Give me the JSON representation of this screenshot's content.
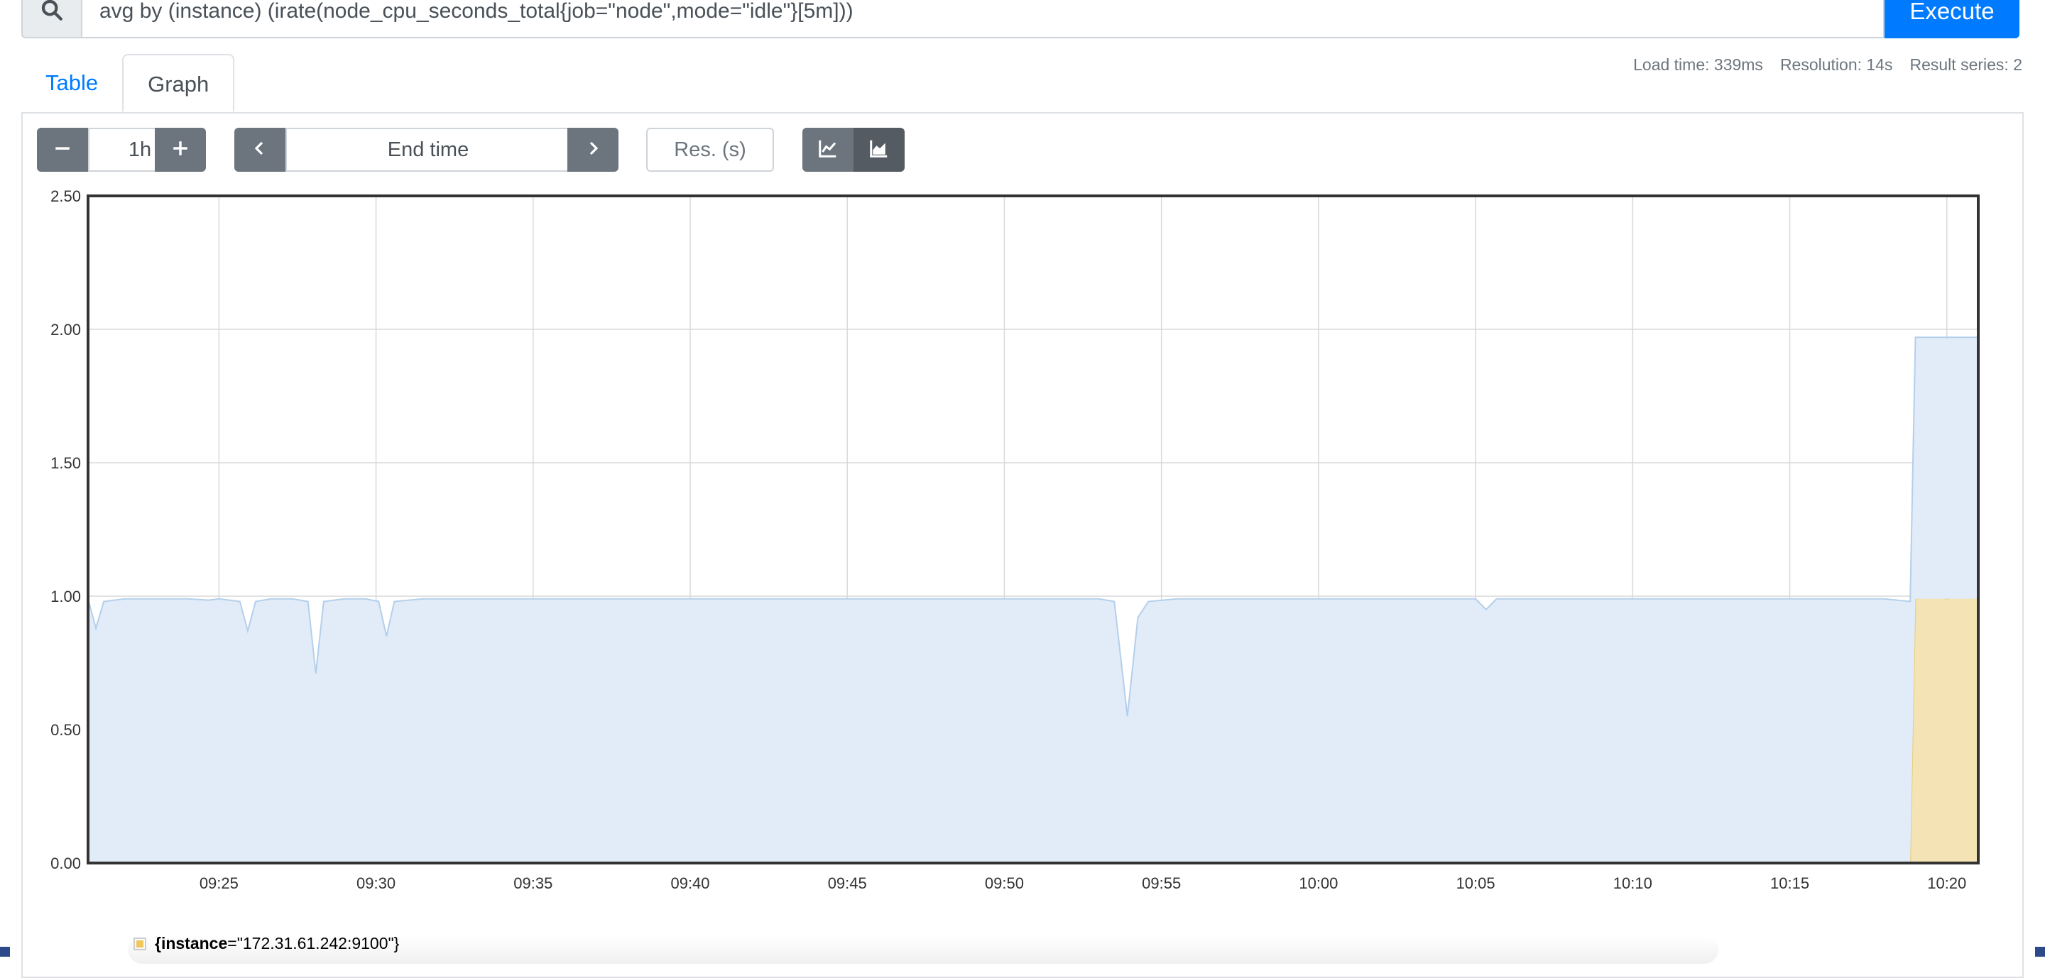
{
  "query": {
    "expression": "avg by (instance) (irate(node_cpu_seconds_total{job=\"node\",mode=\"idle\"}[5m]))",
    "execute_label": "Execute"
  },
  "tabs": [
    {
      "label": "Table"
    },
    {
      "label": "Graph"
    }
  ],
  "stats": {
    "load_time": "Load time: 339ms",
    "resolution": "Resolution: 14s",
    "result_series": "Result series: 2"
  },
  "controls": {
    "range_value": "1h",
    "end_time_placeholder": "End time",
    "resolution_placeholder": "Res. (s)"
  },
  "colors": {
    "series_a_fill": "#e1ecf8",
    "series_a_line": "#b4cfea",
    "series_b_fill": "#f4e4b5",
    "series_b_line": "#e7cc7a",
    "grid": "#d9d9d9",
    "accent": "#007bff"
  },
  "chart_data": {
    "type": "area",
    "stacked": true,
    "grid": true,
    "x_tick_labels": [
      "09:25",
      "09:30",
      "09:35",
      "09:40",
      "09:45",
      "09:50",
      "09:55",
      "10:00",
      "10:05",
      "10:10",
      "10:15",
      "10:20"
    ],
    "y_tick_labels": [
      "0.00",
      "0.50",
      "1.00",
      "1.50",
      "2.00",
      "2.50"
    ],
    "xlim": [
      "09:20:50",
      "10:21:00"
    ],
    "ylim": [
      0,
      2.5
    ],
    "series": [
      {
        "points": [
          [
            "09:20:50",
            0.99
          ],
          [
            "09:21:05",
            0.88
          ],
          [
            "09:21:20",
            0.98
          ],
          [
            "09:22:00",
            0.99
          ],
          [
            "09:23:00",
            0.99
          ],
          [
            "09:24:00",
            0.99
          ],
          [
            "09:24:40",
            0.985
          ],
          [
            "09:25:00",
            0.99
          ],
          [
            "09:25:40",
            0.98
          ],
          [
            "09:25:55",
            0.87
          ],
          [
            "09:26:10",
            0.98
          ],
          [
            "09:26:40",
            0.99
          ],
          [
            "09:27:20",
            0.99
          ],
          [
            "09:27:50",
            0.98
          ],
          [
            "09:28:05",
            0.71
          ],
          [
            "09:28:20",
            0.98
          ],
          [
            "09:29:00",
            0.99
          ],
          [
            "09:29:40",
            0.99
          ],
          [
            "09:30:05",
            0.98
          ],
          [
            "09:30:20",
            0.85
          ],
          [
            "09:30:35",
            0.98
          ],
          [
            "09:31:30",
            0.99
          ],
          [
            "09:32:30",
            0.99
          ],
          [
            "09:33:30",
            0.99
          ],
          [
            "09:35:00",
            0.99
          ],
          [
            "09:36:00",
            0.99
          ],
          [
            "09:37:00",
            0.99
          ],
          [
            "09:38:00",
            0.99
          ],
          [
            "09:39:00",
            0.99
          ],
          [
            "09:40:00",
            0.99
          ],
          [
            "09:41:00",
            0.99
          ],
          [
            "09:42:00",
            0.99
          ],
          [
            "09:43:00",
            0.99
          ],
          [
            "09:44:00",
            0.99
          ],
          [
            "09:45:00",
            0.99
          ],
          [
            "09:46:00",
            0.99
          ],
          [
            "09:47:00",
            0.99
          ],
          [
            "09:48:00",
            0.99
          ],
          [
            "09:49:00",
            0.99
          ],
          [
            "09:50:00",
            0.99
          ],
          [
            "09:51:00",
            0.99
          ],
          [
            "09:52:00",
            0.99
          ],
          [
            "09:53:00",
            0.99
          ],
          [
            "09:53:30",
            0.98
          ],
          [
            "09:53:55",
            0.55
          ],
          [
            "09:54:15",
            0.92
          ],
          [
            "09:54:35",
            0.98
          ],
          [
            "09:55:30",
            0.99
          ],
          [
            "09:56:30",
            0.99
          ],
          [
            "09:57:30",
            0.99
          ],
          [
            "09:58:30",
            0.99
          ],
          [
            "10:00:00",
            0.99
          ],
          [
            "10:01:00",
            0.99
          ],
          [
            "10:02:00",
            0.99
          ],
          [
            "10:03:00",
            0.99
          ],
          [
            "10:04:00",
            0.99
          ],
          [
            "10:05:00",
            0.99
          ],
          [
            "10:05:20",
            0.95
          ],
          [
            "10:05:40",
            0.99
          ],
          [
            "10:07:00",
            0.99
          ],
          [
            "10:08:00",
            0.99
          ],
          [
            "10:09:00",
            0.99
          ],
          [
            "10:10:00",
            0.99
          ],
          [
            "10:11:00",
            0.99
          ],
          [
            "10:12:00",
            0.99
          ],
          [
            "10:13:00",
            0.99
          ],
          [
            "10:14:00",
            0.99
          ],
          [
            "10:15:00",
            0.99
          ],
          [
            "10:16:00",
            0.99
          ],
          [
            "10:17:00",
            0.99
          ],
          [
            "10:18:00",
            0.99
          ],
          [
            "10:18:50",
            0.98
          ],
          [
            "10:19:00",
            0.98
          ],
          [
            "10:20:00",
            0.98
          ],
          [
            "10:21:00",
            0.98
          ]
        ]
      },
      {
        "name": "{instance=\"172.31.61.242:9100\"}",
        "points": [
          [
            "10:18:50",
            0.0
          ],
          [
            "10:19:00",
            0.99
          ],
          [
            "10:19:30",
            1.0
          ],
          [
            "10:20:00",
            0.99
          ],
          [
            "10:20:30",
            1.0
          ],
          [
            "10:21:00",
            0.99
          ]
        ]
      }
    ],
    "legend_placement": "bottom-left"
  }
}
